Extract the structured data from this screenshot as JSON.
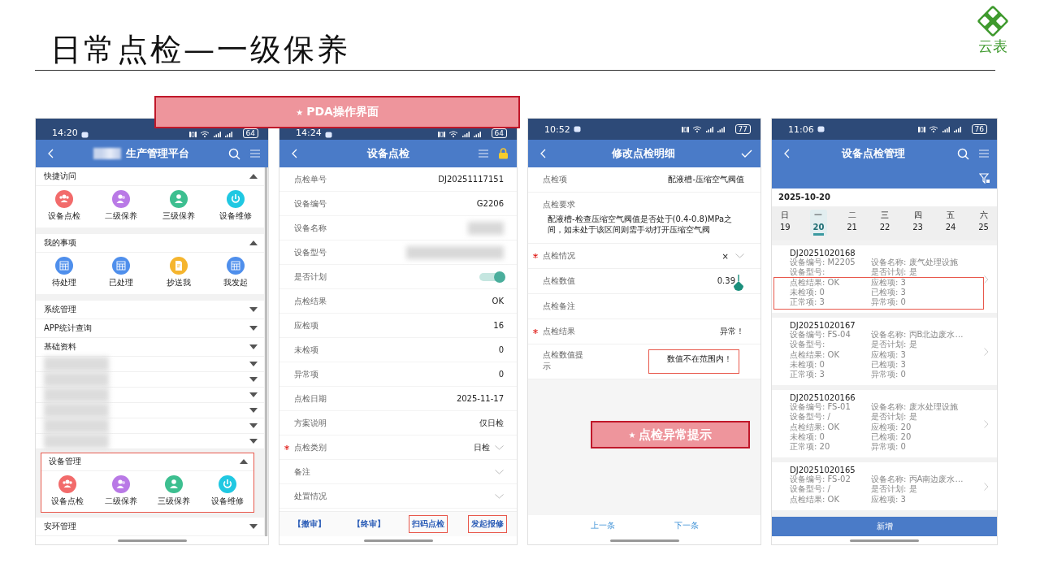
{
  "slide": {
    "title": "日常点检—一级保养",
    "logo_text": "云表"
  },
  "callouts": [
    {
      "star": "★",
      "text": "PDA操作界面"
    },
    {
      "star": "★",
      "text": "点检异常提示"
    }
  ],
  "home_screen": {
    "status": {
      "time": "14:20",
      "battery": "64"
    },
    "title": "生产管理平台",
    "sections": [
      {
        "kind": "group",
        "title": "快捷访问",
        "expanded": true,
        "highlighted": false,
        "items": [
          {
            "label": "设备点检",
            "kind": "team",
            "color": "#f26b6b"
          },
          {
            "label": "二级保养",
            "kind": "pair",
            "color": "#b979e6"
          },
          {
            "label": "三级保养",
            "kind": "person",
            "color": "#3dbf90"
          },
          {
            "label": "设备维修",
            "kind": "power",
            "color": "#20c8e2"
          }
        ]
      },
      {
        "kind": "group",
        "title": "我的事项",
        "expanded": true,
        "highlighted": false,
        "items": [
          {
            "label": "待处理",
            "kind": "grid",
            "color": "#4f8fec"
          },
          {
            "label": "已处理",
            "kind": "grid",
            "color": "#4f8fec"
          },
          {
            "label": "抄送我",
            "kind": "doc",
            "color": "#f5b52e"
          },
          {
            "label": "我发起",
            "kind": "grid",
            "color": "#4f8fec"
          }
        ]
      },
      {
        "kind": "group",
        "title": "系统管理",
        "expanded": false,
        "highlighted": false
      },
      {
        "kind": "group",
        "title": "APP统计查询",
        "expanded": false,
        "highlighted": false
      },
      {
        "kind": "group",
        "title": "基础资料",
        "expanded": false,
        "highlighted": false
      },
      {
        "kind": "blurred",
        "expanded": false
      },
      {
        "kind": "blurred",
        "expanded": false
      },
      {
        "kind": "blurred",
        "expanded": false
      },
      {
        "kind": "blurred",
        "expanded": false
      },
      {
        "kind": "blurred",
        "expanded": false
      },
      {
        "kind": "blurred",
        "expanded": false
      },
      {
        "kind": "group",
        "title": "设备管理",
        "expanded": true,
        "highlighted": true,
        "items": [
          {
            "label": "设备点检",
            "kind": "team",
            "color": "#f26b6b"
          },
          {
            "label": "二级保养",
            "kind": "pair",
            "color": "#b979e6"
          },
          {
            "label": "三级保养",
            "kind": "person",
            "color": "#3dbf90"
          },
          {
            "label": "设备维修",
            "kind": "power",
            "color": "#20c8e2"
          }
        ]
      },
      {
        "kind": "group",
        "title": "安环管理",
        "expanded": false,
        "highlighted": false
      }
    ]
  },
  "inspection_form": {
    "status": {
      "time": "14:24",
      "battery": "64"
    },
    "title": "设备点检",
    "rows": [
      {
        "kind": "text",
        "label": "点检单号",
        "value": "DJ20251117151",
        "required": false
      },
      {
        "kind": "text",
        "label": "设备编号",
        "value": "G2206",
        "required": false
      },
      {
        "kind": "blurred",
        "label": "设备名称",
        "required": false
      },
      {
        "kind": "blurred",
        "label": "设备型号",
        "required": false
      },
      {
        "kind": "toggle",
        "label": "是否计划",
        "on": true,
        "required": false
      },
      {
        "kind": "text",
        "label": "点检结果",
        "value": "OK",
        "required": false
      },
      {
        "kind": "text",
        "label": "应检项",
        "value": "16",
        "required": false
      },
      {
        "kind": "text",
        "label": "未检项",
        "value": "0",
        "required": false
      },
      {
        "kind": "text",
        "label": "异常项",
        "value": "0",
        "required": false
      },
      {
        "kind": "text",
        "label": "点检日期",
        "value": "2025-11-17",
        "required": false
      },
      {
        "kind": "text",
        "label": "方案说明",
        "value": "仅日检",
        "required": false
      },
      {
        "kind": "select",
        "label": "点检类别",
        "value": "日检",
        "required": true
      },
      {
        "kind": "select",
        "label": "备注",
        "required": false
      },
      {
        "kind": "select",
        "label": "处置情况",
        "required": false
      }
    ],
    "actions": [
      {
        "label": "【撤审】",
        "highlighted": false
      },
      {
        "label": "【终审】",
        "highlighted": false
      },
      {
        "label": "扫码点检",
        "highlighted": true
      },
      {
        "label": "发起报修",
        "highlighted": true
      }
    ]
  },
  "detail_edit": {
    "status": {
      "time": "10:52",
      "battery": "77"
    },
    "title": "修改点检明细",
    "rows": [
      {
        "kind": "text",
        "label": "点检项",
        "value": "配液槽-压缩空气阀值",
        "required": false
      },
      {
        "kind": "note",
        "label": "点检要求",
        "value": "配液槽-检查压缩空气阀值是否处于(0.4-0.8)MPa之间，如未处于该区间则需手动打开压缩空气阀",
        "required": false
      },
      {
        "kind": "select",
        "label": "点检情况",
        "value": "×",
        "required": true
      },
      {
        "kind": "input",
        "label": "点检数值",
        "value": "0.39",
        "required": false
      },
      {
        "kind": "input",
        "label": "点检备注",
        "required": false
      },
      {
        "kind": "text",
        "label": "点检结果",
        "value": "异常！",
        "required": true
      },
      {
        "kind": "hint",
        "label": "点检数值提示",
        "value": "数值不在范围内！",
        "required": false,
        "highlighted": true
      }
    ],
    "nav": [
      "上一条",
      "下一条"
    ]
  },
  "inspection_list": {
    "status": {
      "time": "11:06",
      "battery": "76"
    },
    "title": "设备点检管理",
    "date": "2025-10-20",
    "week": [
      {
        "weekday": "日",
        "day": "19",
        "selected": false
      },
      {
        "weekday": "一",
        "day": "20",
        "selected": true
      },
      {
        "weekday": "二",
        "day": "21",
        "selected": false
      },
      {
        "weekday": "三",
        "day": "22",
        "selected": false
      },
      {
        "weekday": "四",
        "day": "23",
        "selected": false
      },
      {
        "weekday": "五",
        "day": "24",
        "selected": false
      },
      {
        "weekday": "六",
        "day": "25",
        "selected": false
      }
    ],
    "cards": [
      {
        "number": "DJ20251020168",
        "fields": [
          "设备编号: M2205",
          "设备名称: 废气处理设施",
          "设备型号:",
          "是否计划: 是"
        ],
        "results": [
          "点检结果: OK",
          "应检项: 3",
          "未检项: 0",
          "已检项: 3",
          "正常项: 3",
          "异常项: 0"
        ],
        "highlighted": true
      },
      {
        "number": "DJ20251020167",
        "fields": [
          "设备编号: FS-04",
          "设备名称: 丙B北边废水…",
          "设备型号:",
          "是否计划: 是"
        ],
        "results": [
          "点检结果: OK",
          "应检项: 3",
          "未检项: 0",
          "已检项: 3",
          "正常项: 3",
          "异常项: 0"
        ],
        "highlighted": false
      },
      {
        "number": "DJ20251020166",
        "fields": [
          "设备编号: FS-01",
          "设备名称: 废水处理设施",
          "设备型号: /",
          "是否计划: 是"
        ],
        "results": [
          "点检结果: OK",
          "应检项: 20",
          "未检项: 0",
          "已检项: 20",
          "正常项: 20",
          "异常项: 0"
        ],
        "highlighted": false
      },
      {
        "number": "DJ20251020165",
        "fields": [
          "设备编号: FS-02",
          "设备名称: 丙A南边废水…",
          "设备型号: /",
          "是否计划: 是"
        ],
        "results": [
          "点检结果: OK",
          "应检项: 3"
        ],
        "highlighted": false
      }
    ],
    "add_button": "新增"
  }
}
